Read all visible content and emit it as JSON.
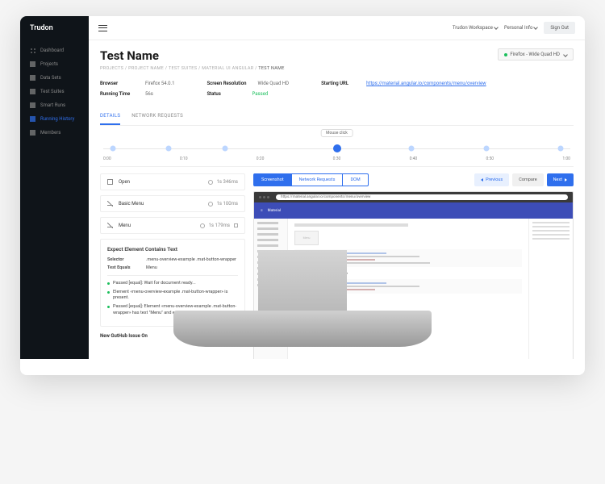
{
  "brand": "Trudon",
  "nav": {
    "items": [
      {
        "label": "Dashboard"
      },
      {
        "label": "Projects"
      },
      {
        "label": "Data Sets"
      },
      {
        "label": "Test Suites"
      },
      {
        "label": "Smart Runs"
      },
      {
        "label": "Running History"
      },
      {
        "label": "Members"
      }
    ]
  },
  "topbar": {
    "workspace": "Trudon Workspace",
    "personal": "Personal Info",
    "signout": "Sign Out"
  },
  "page": {
    "title": "Test Name",
    "badge": "Firefox - Wide Quad HD",
    "crumbs": {
      "a": "PROJECTS",
      "b": "PROJECT NAME",
      "c": "TEST SUITES",
      "d": "MATERIAL UI ANGULAR",
      "current": "TEST NAME"
    }
  },
  "meta": {
    "browser_l": "Browser",
    "browser_v": "Firefox 54.0.1",
    "runtime_l": "Running Time",
    "runtime_v": "56s",
    "res_l": "Screen Resolution",
    "res_v": "Wide Quad HD",
    "status_l": "Status",
    "status_v": "Passed",
    "url_l": "Starting URL",
    "url_v": "https://material.angular.io/components/menu/overview"
  },
  "tabs": {
    "details": "DETAILS",
    "network": "NETWORK REQUESTS"
  },
  "timeline": {
    "badge": "Mouse click",
    "ticks": [
      "0:00",
      "0:10",
      "0:20",
      "0:30",
      "0:40",
      "0:50",
      "1:00"
    ]
  },
  "steps": [
    {
      "name": "Open",
      "time": "1s 346ms"
    },
    {
      "name": "Basic Menu",
      "time": "1s 100ms"
    },
    {
      "name": "Menu",
      "time": "1s 179ms"
    }
  ],
  "detail": {
    "heading": "Expect Element Contains Text",
    "selector_l": "Selector",
    "selector_v": ".menu-overview-example .mat-button-wrapper",
    "equals_l": "Test Equals",
    "equals_v": "Menu",
    "bullets": [
      "Passed [equal]: Wait for document ready...",
      "Element «menu-overview-example .mat-button-wrapper» is present.",
      "Passed [equal]: Element «menu-overview-example .mat-button-wrapper» has text \"Menu\" and equals \"Menu\"."
    ],
    "issue": "New GutHub Issue On"
  },
  "viewer": {
    "seg": {
      "screenshot": "Screenshot",
      "network": "Network Requests",
      "dom": "DOM"
    },
    "actions": {
      "prev": "Previous",
      "compare": "Compare",
      "next": "Next"
    },
    "url": "https://material.angular.io/components/menu/overview",
    "box_label": "Menu",
    "heading": "Toggling the menu programmatically"
  }
}
